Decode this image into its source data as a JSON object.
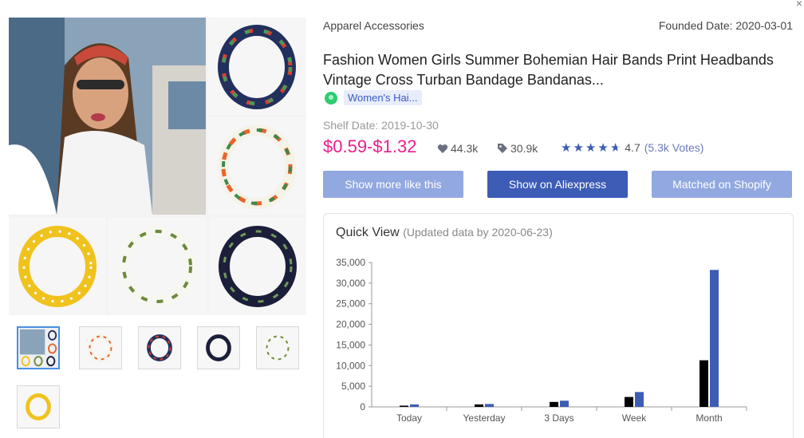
{
  "category": "Apparel Accessories",
  "founded_date": "Founded Date: 2020-03-01",
  "title": "Fashion Women Girls Summer Bohemian Hair Bands Print Headbands Vintage Cross Turban Bandage Bandanas...",
  "category_tag": "Women's Hai...",
  "shelf_date": "Shelf Date: 2019-10-30",
  "price": "$0.59-$1.32",
  "likes": "44.3k",
  "tags": "30.9k",
  "rating": "4.7",
  "votes": "(5.3k Votes)",
  "stars": 4.7,
  "buttons": {
    "more_like": "Show more like this",
    "aliexpress": "Show on Aliexpress",
    "shopify": "Matched on Shopify"
  },
  "quick_view": {
    "title": "Quick View",
    "subtitle": "(Updated data by 2020-06-23)"
  },
  "close_glyph": "×",
  "colors": {
    "accent": "#3c5cb5",
    "accent_light": "#91a8e0",
    "price": "#e91e8c",
    "bar_black": "#000000",
    "bar_blue": "#3c5cb5"
  },
  "icons": [
    "heart-icon",
    "tag-icon",
    "star-icon",
    "green-dot-icon",
    "close-icon"
  ],
  "chart_data": {
    "type": "bar",
    "categories": [
      "Today",
      "Yesterday",
      "3 Days",
      "Week",
      "Month"
    ],
    "series": [
      {
        "values": [
          300,
          600,
          1200,
          2400,
          11300
        ]
      },
      {
        "values": [
          600,
          700,
          1500,
          3600,
          33200
        ]
      }
    ],
    "yticks": [
      "35,000",
      "30,000",
      "25,000",
      "20,000",
      "15,000",
      "10,000",
      "5,000",
      "0"
    ],
    "ylim": [
      0,
      35000
    ],
    "grid": false
  }
}
